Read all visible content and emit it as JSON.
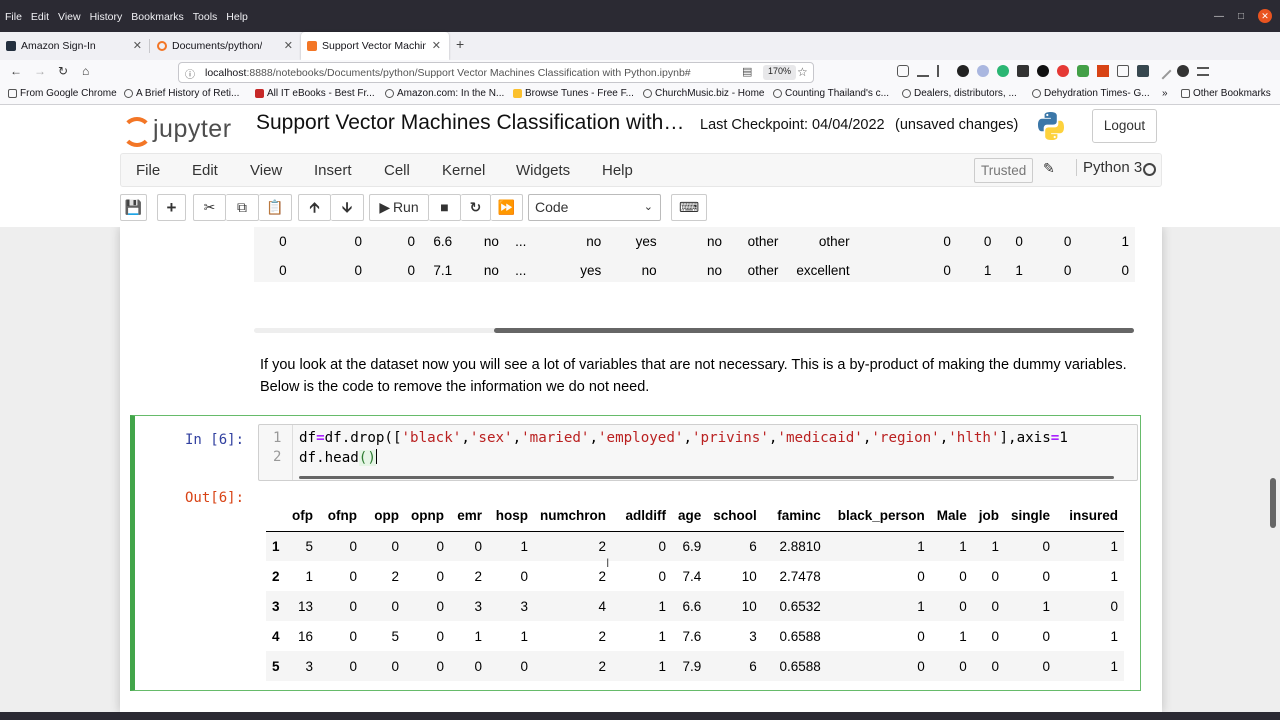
{
  "browser": {
    "menu": [
      "File",
      "Edit",
      "View",
      "History",
      "Bookmarks",
      "Tools",
      "Help"
    ],
    "tabs": [
      {
        "label": "Amazon Sign-In",
        "active": false
      },
      {
        "label": "Documents/python/",
        "active": false
      },
      {
        "label": "Support Vector Machines",
        "active": true
      }
    ],
    "url_host": "localhost",
    "url_rest": ":8888/notebooks/Documents/python/Support Vector Machines Classification with Python.ipynb#",
    "zoom": "170%",
    "bookmarks": [
      "From Google Chrome",
      "A Brief History of Reti...",
      "All IT eBooks - Best Fr...",
      "Amazon.com: In the N...",
      "Browse Tunes - Free F...",
      "ChurchMusic.biz - Home",
      "Counting Thailand's c...",
      "Dealers, distributors, ...",
      "Dehydration Times- G...",
      "Other Bookmarks"
    ]
  },
  "jupyter": {
    "logo_text": "jupyter",
    "title": "Support Vector Machines Classification with…",
    "checkpoint": "Last Checkpoint: 04/04/2022",
    "save_status": "(unsaved changes)",
    "logout_label": "Logout",
    "menu": [
      "File",
      "Edit",
      "View",
      "Insert",
      "Cell",
      "Kernel",
      "Widgets",
      "Help"
    ],
    "trusted_label": "Trusted",
    "kernel_name": "Python 3",
    "run_label": "Run",
    "cell_type": "Code"
  },
  "notebook": {
    "top_output_rows": [
      [
        "0",
        "0",
        "0",
        "6.6",
        "no",
        "...",
        "no",
        "yes",
        "no",
        "other",
        "other",
        "0",
        "0",
        "0",
        "0",
        "1"
      ],
      [
        "0",
        "0",
        "0",
        "7.1",
        "no",
        "...",
        "yes",
        "no",
        "no",
        "other",
        "excellent",
        "0",
        "1",
        "1",
        "0",
        "0"
      ]
    ],
    "markdown": "If you look at the dataset now you will see a lot of variables that are not necessary. This is a by-product of making the dummy variables. Below is the code to remove the information we do not need.",
    "cell": {
      "in_prompt": "In [6]:",
      "out_prompt": "Out[6]:",
      "line_numbers": [
        "1",
        "2"
      ]
    },
    "output_table": {
      "columns": [
        "ofp",
        "ofnp",
        "opp",
        "opnp",
        "emr",
        "hosp",
        "numchron",
        "adldiff",
        "age",
        "school",
        "faminc",
        "black_person",
        "Male",
        "job",
        "single",
        "insured"
      ],
      "rows": [
        {
          "index": "1",
          "values": [
            "5",
            "0",
            "0",
            "0",
            "0",
            "1",
            "2",
            "0",
            "6.9",
            "6",
            "2.8810",
            "1",
            "1",
            "1",
            "0",
            "1"
          ]
        },
        {
          "index": "2",
          "values": [
            "1",
            "0",
            "2",
            "0",
            "2",
            "0",
            "2",
            "0",
            "7.4",
            "10",
            "2.7478",
            "0",
            "0",
            "0",
            "0",
            "1"
          ]
        },
        {
          "index": "3",
          "values": [
            "13",
            "0",
            "0",
            "0",
            "3",
            "3",
            "4",
            "1",
            "6.6",
            "10",
            "0.6532",
            "1",
            "0",
            "0",
            "1",
            "0"
          ]
        },
        {
          "index": "4",
          "values": [
            "16",
            "0",
            "5",
            "0",
            "1",
            "1",
            "2",
            "1",
            "7.6",
            "3",
            "0.6588",
            "0",
            "1",
            "0",
            "0",
            "1"
          ]
        },
        {
          "index": "5",
          "values": [
            "3",
            "0",
            "0",
            "0",
            "0",
            "0",
            "2",
            "1",
            "7.9",
            "6",
            "0.6588",
            "0",
            "0",
            "0",
            "0",
            "1"
          ]
        }
      ]
    }
  },
  "colors": {
    "jupyter_orange": "#f37626",
    "cell_selected_border": "#42a54a",
    "in_prompt": "#303f9f",
    "out_prompt": "#d84315",
    "string": "#ba2121",
    "operator": "#aa22ff"
  }
}
